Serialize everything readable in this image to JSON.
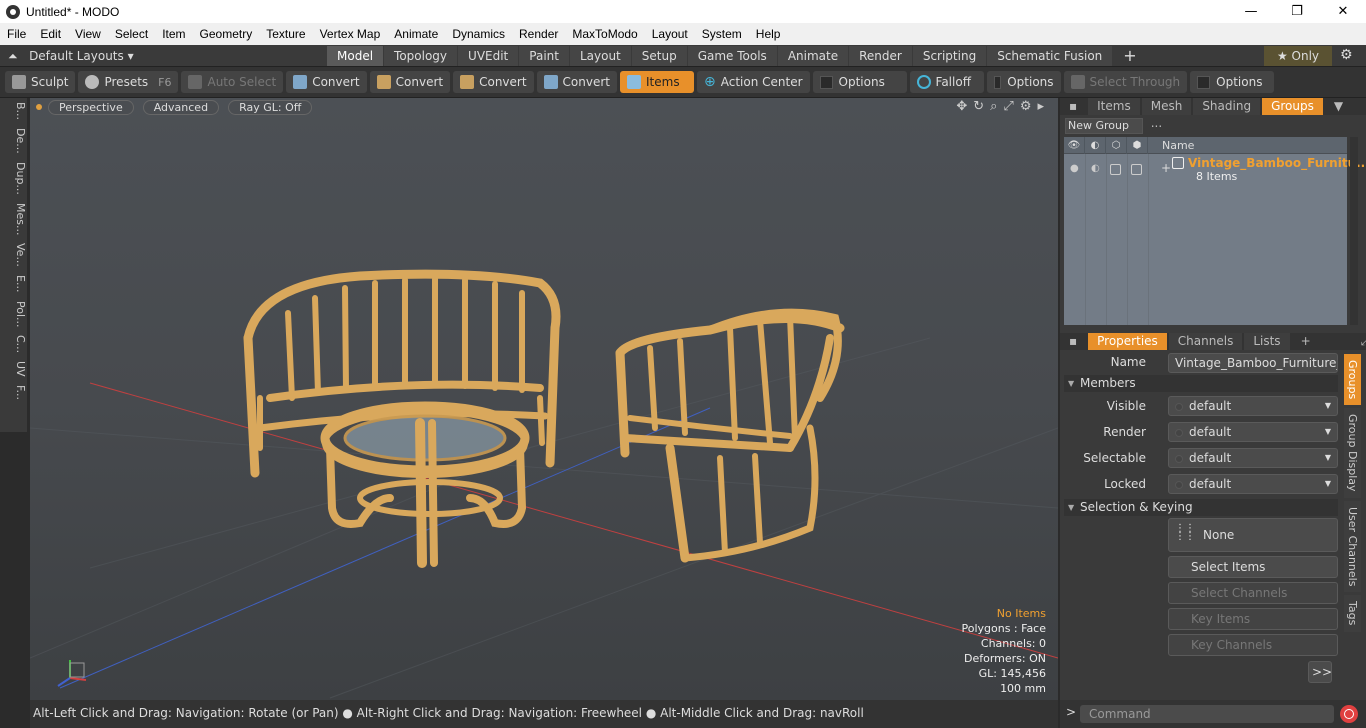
{
  "window": {
    "title": "Untitled* - MODO",
    "minimize": "—",
    "maximize": "❐",
    "close": "✕"
  },
  "menu": [
    "File",
    "Edit",
    "View",
    "Select",
    "Item",
    "Geometry",
    "Texture",
    "Vertex Map",
    "Animate",
    "Dynamics",
    "Render",
    "MaxToModo",
    "Layout",
    "System",
    "Help"
  ],
  "layoutbar": {
    "layouts_label": "Default Layouts ▾",
    "tabs": [
      "Model",
      "Topology",
      "UVEdit",
      "Paint",
      "Layout",
      "Setup",
      "Game Tools",
      "Animate",
      "Render",
      "Scripting",
      "Schematic Fusion"
    ],
    "active_tab": "Model",
    "only_label": "★  Only"
  },
  "toolbar": {
    "sculpt": "Sculpt",
    "presets": "Presets",
    "presets_key": "F6",
    "auto_select": "Auto Select",
    "convert1": "Convert",
    "convert2": "Convert",
    "convert3": "Convert",
    "convert4": "Convert",
    "items": "Items",
    "action_center": "Action Center",
    "options1": "Options",
    "falloff": "Falloff",
    "options2": "Options",
    "select_through": "Select Through",
    "options3": "Options"
  },
  "lefttabs": [
    "B...",
    "De...",
    "Dup...",
    "Mes...",
    "Ve...",
    "E...",
    "Pol...",
    "C...",
    "UV",
    "F..."
  ],
  "viewport": {
    "perspective": "Perspective",
    "advanced": "Advanced",
    "raygl": "Ray GL: Off",
    "info": {
      "no_items": "No Items",
      "polygons": "Polygons : Face",
      "channels": "Channels: 0",
      "deformers": "Deformers: ON",
      "gl": "GL: 145,456",
      "scale": "100 mm"
    }
  },
  "statusbar": "Alt-Left Click and Drag: Navigation: Rotate (or Pan) ● Alt-Right Click and Drag: Navigation: Freewheel ● Alt-Middle Click and Drag: navRoll",
  "panel": {
    "tabs": [
      "Items",
      "Mesh ...",
      "Shading",
      "Groups"
    ],
    "active_tab": "Groups",
    "new_group": "New Group",
    "name_col": "Name",
    "group_name": "Vintage_Bamboo_Furnitu...",
    "group_count": "8 Items"
  },
  "properties": {
    "tabs": [
      "Properties",
      "Channels",
      "Lists"
    ],
    "active_tab": "Properties",
    "name_label": "Name",
    "name_value": "Vintage_Bamboo_Furniture_Set",
    "members_section": "Members",
    "visible_label": "Visible",
    "visible_value": "default",
    "render_label": "Render",
    "render_value": "default",
    "selectable_label": "Selectable",
    "selectable_value": "default",
    "locked_label": "Locked",
    "locked_value": "default",
    "keying_section": "Selection & Keying",
    "none_btn": "None",
    "select_items": "Select Items",
    "select_channels": "Select Channels",
    "key_items": "Key Items",
    "key_channels": "Key Channels",
    "more": ">>",
    "side_tabs": [
      "Groups",
      "Group Display",
      "User Channels",
      "Tags"
    ]
  },
  "command": {
    "placeholder": "Command",
    "arrow": ">"
  },
  "colors": {
    "accent": "#e8902a",
    "group_name": "#f0a030",
    "bamboo": "#d9a85c"
  }
}
